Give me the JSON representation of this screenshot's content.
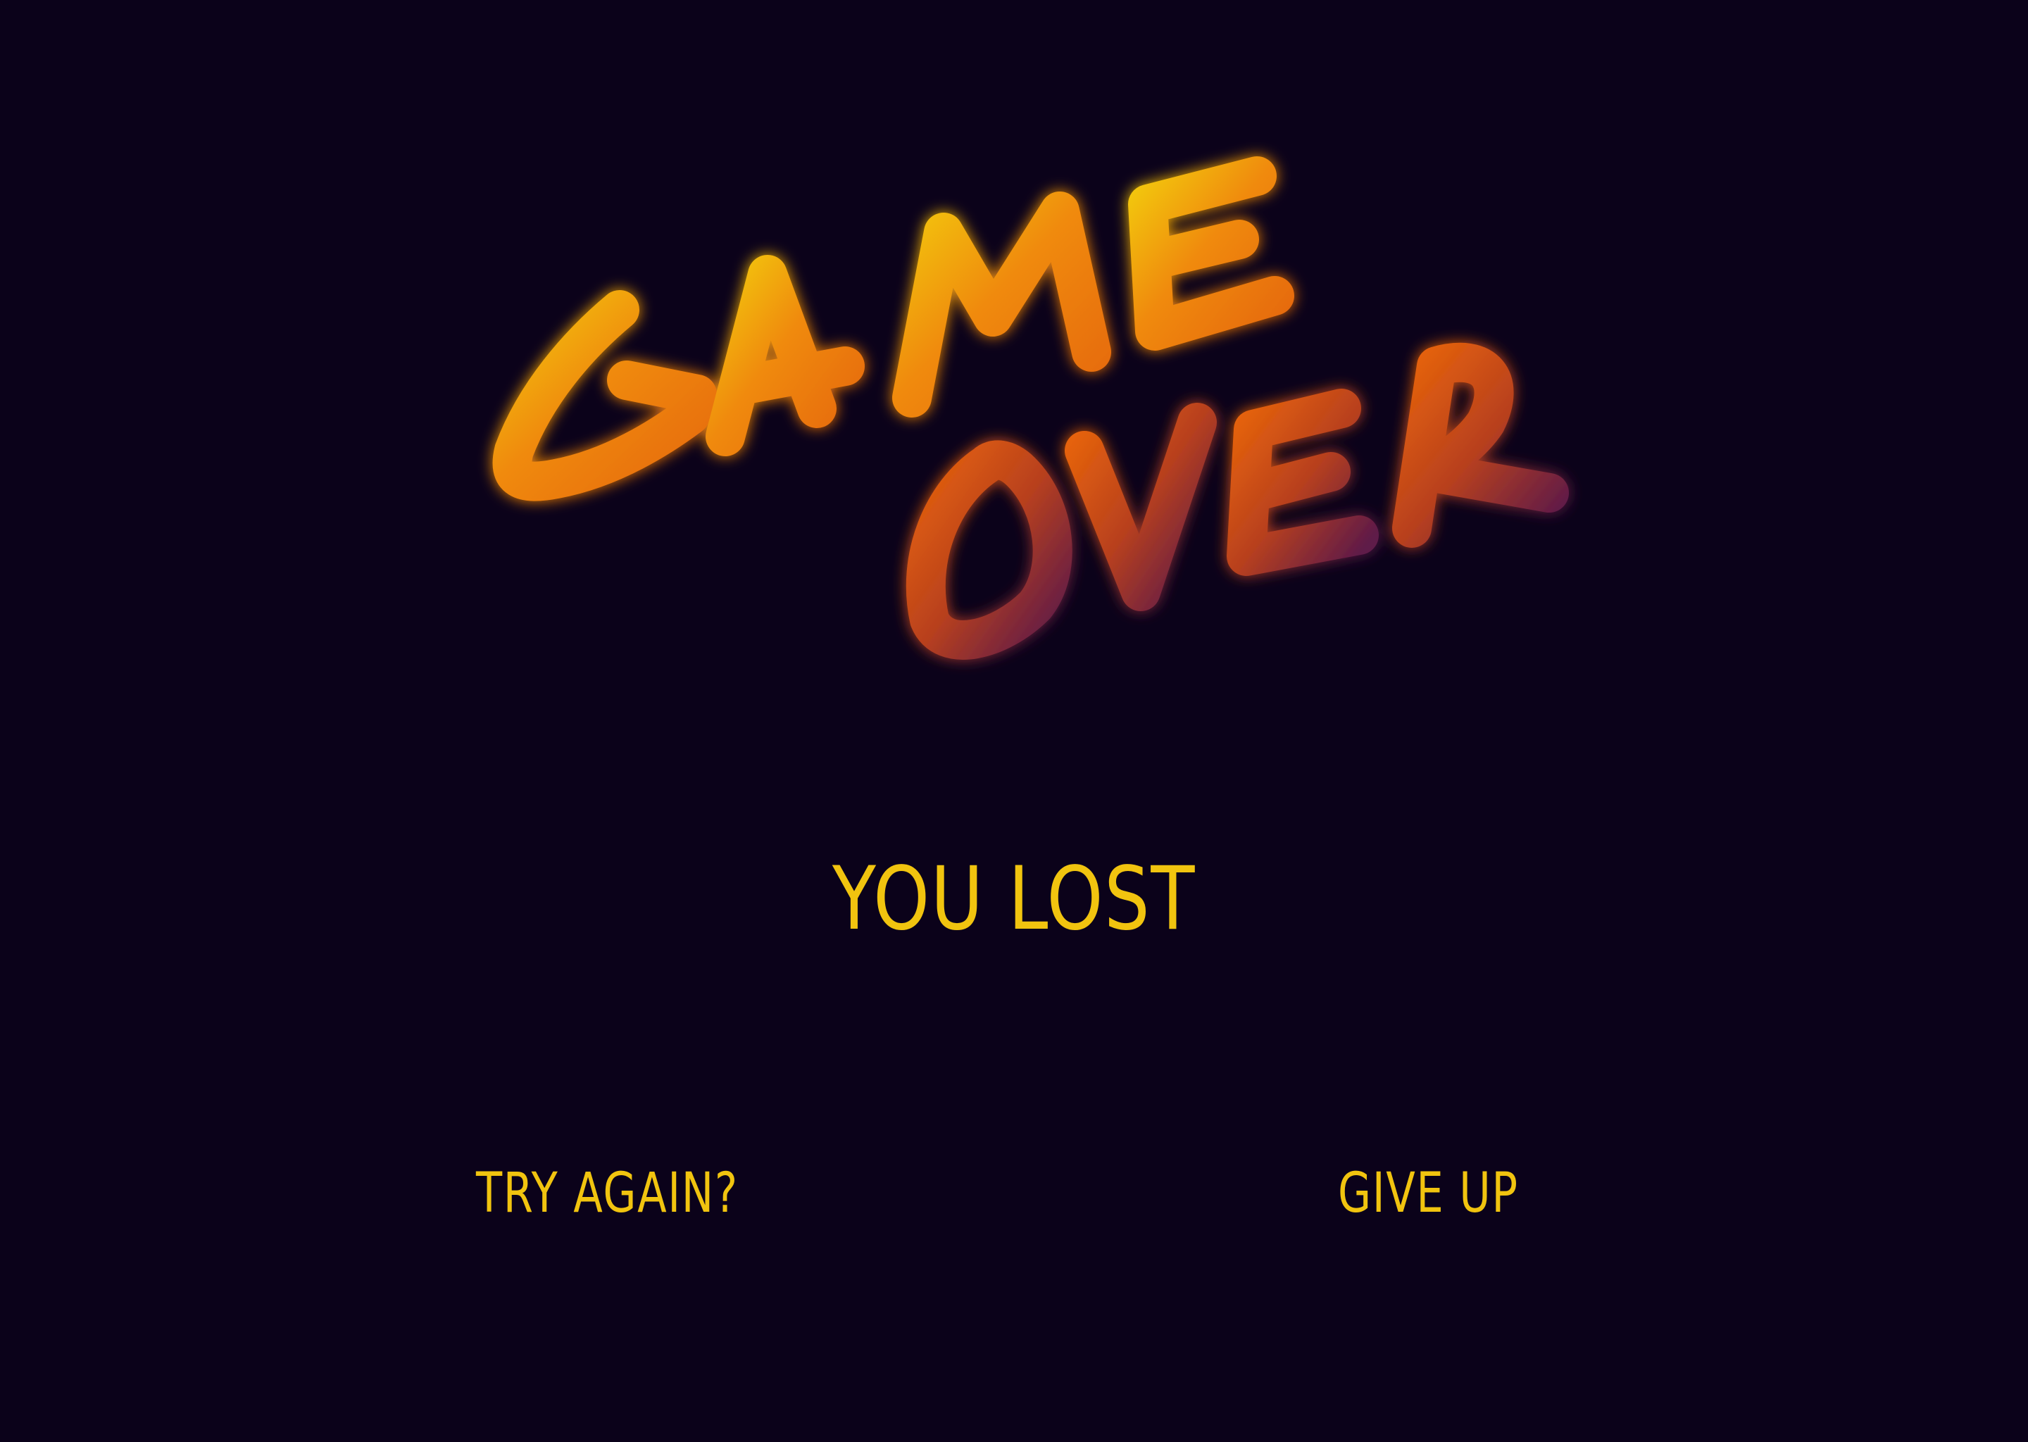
{
  "title": {
    "line1": "GAME",
    "line2": "OVER",
    "gradient_colors": [
      "#f2c40a",
      "#f0800a",
      "#e0600d",
      "#6b1d4a"
    ]
  },
  "status": {
    "message": "YOU LOST"
  },
  "menu": {
    "try_again_label": "TRY AGAIN?",
    "give_up_label": "GIVE UP"
  },
  "colors": {
    "background": "#0b021a",
    "text_accent": "#f1c40f"
  }
}
